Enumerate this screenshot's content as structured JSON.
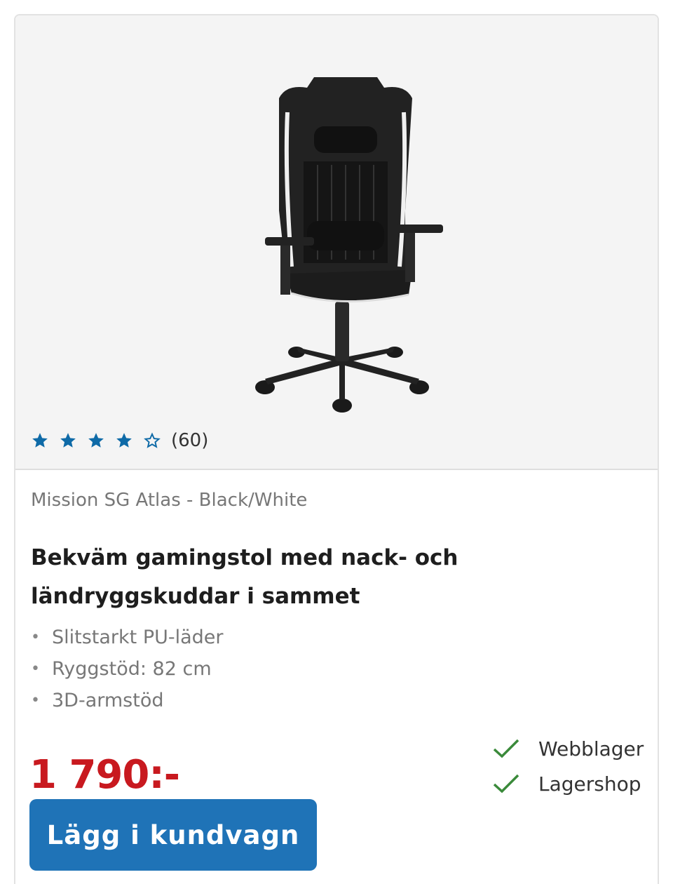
{
  "product": {
    "rating": {
      "value": 4,
      "max": 5,
      "count_label": "(60)",
      "star_color": "#0e6aa7"
    },
    "brand_line": "Mission SG Atlas - Black/White",
    "title": "Bekväm gamingstol med nack- och ländryggskuddar i sammet",
    "features": [
      "Slitstarkt PU-läder",
      "Ryggstöd: 82 cm",
      "3D-armstöd"
    ],
    "price": "1 790:-",
    "price_color": "#c8191f",
    "stock": [
      {
        "label": "Webblager",
        "icon": "check-icon",
        "color": "#3a8a3a"
      },
      {
        "label": "Lagershop",
        "icon": "check-icon",
        "color": "#3a8a3a"
      }
    ],
    "add_to_cart_label": "Lägg i kundvagn",
    "button_color": "#1f73b7"
  }
}
